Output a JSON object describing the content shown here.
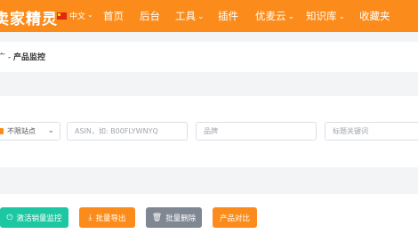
{
  "header": {
    "logo": "卖家精灵",
    "language": "中文",
    "nav": [
      {
        "label": "首页",
        "dropdown": false
      },
      {
        "label": "后台",
        "dropdown": false
      },
      {
        "label": "工具",
        "dropdown": true
      },
      {
        "label": "插件",
        "dropdown": false
      },
      {
        "label": "优麦云",
        "dropdown": true
      },
      {
        "label": "知识库",
        "dropdown": true
      },
      {
        "label": "收藏夹",
        "dropdown": false
      }
    ]
  },
  "breadcrumb": {
    "parent": "广",
    "separator": "-",
    "current": "产品监控"
  },
  "filters": {
    "site_select": "不限站点",
    "asin_placeholder": "ASIN，如: B00FLYWNYQ",
    "brand_placeholder": "品牌",
    "title_placeholder": "标题关键词"
  },
  "actions": {
    "activate_sales_monitor": "激活销量监控",
    "bulk_export": "批量导出",
    "bulk_delete": "批量删除",
    "compare_products": "产品对比"
  },
  "colors": {
    "brand_orange": "#fb8c1b",
    "teal": "#1cc7a1",
    "gray": "#7f8792"
  }
}
